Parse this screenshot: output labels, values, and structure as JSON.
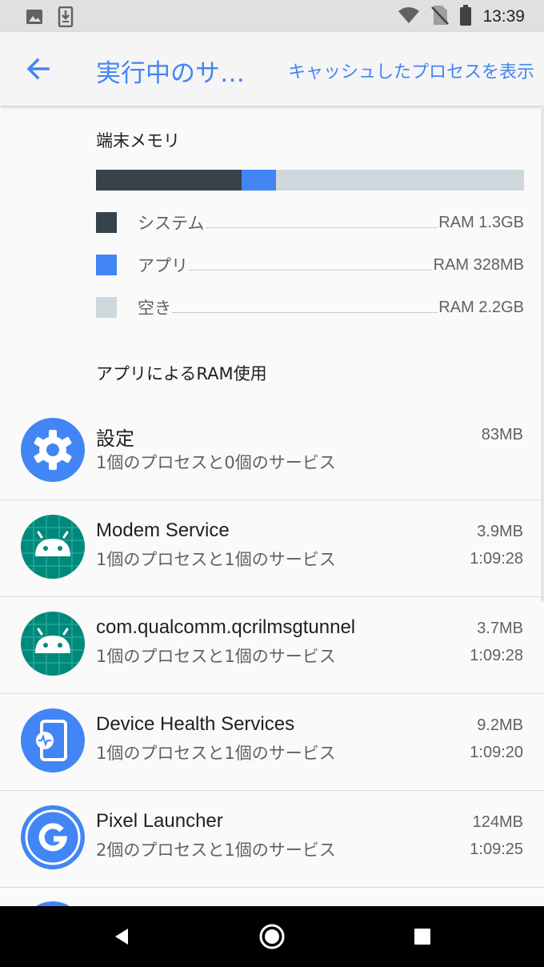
{
  "status_bar": {
    "time": "13:39",
    "icons": [
      "image-icon",
      "download-icon",
      "wifi-icon",
      "no-sim-icon",
      "battery-icon"
    ]
  },
  "app_bar": {
    "title": "実行中のサ…",
    "action": "キャッシュしたプロセスを表示"
  },
  "memory": {
    "title": "端末メモリ",
    "bar": {
      "system_fraction": 0.34,
      "apps_fraction": 0.08,
      "free_fraction": 0.58
    },
    "legend": [
      {
        "label": "システム",
        "value": "RAM 1.3GB",
        "color": "#37424a"
      },
      {
        "label": "アプリ",
        "value": "RAM 328MB",
        "color": "#4285f4"
      },
      {
        "label": "空き",
        "value": "RAM 2.2GB",
        "color": "#cfd8dc"
      }
    ]
  },
  "apps_section_title": "アプリによるRAM使用",
  "apps": [
    {
      "name": "設定",
      "detail": "1個のプロセスと0個のサービス",
      "size": "83MB",
      "time": "",
      "icon": "settings-gear-icon"
    },
    {
      "name": "Modem Service",
      "detail": "1個のプロセスと1個のサービス",
      "size": "3.9MB",
      "time": "1:09:28",
      "icon": "android-icon"
    },
    {
      "name": "com.qualcomm.qcrilmsgtunnel",
      "detail": "1個のプロセスと1個のサービス",
      "size": "3.7MB",
      "time": "1:09:28",
      "icon": "android-icon"
    },
    {
      "name": "Device Health Services",
      "detail": "1個のプロセスと1個のサービス",
      "size": "9.2MB",
      "time": "1:09:20",
      "icon": "device-health-icon"
    },
    {
      "name": "Pixel Launcher",
      "detail": "2個のプロセスと1個のサービス",
      "size": "124MB",
      "time": "1:09:25",
      "icon": "google-g-icon"
    }
  ],
  "colors": {
    "accent": "#4285f4",
    "android_teal": "#00897b"
  }
}
